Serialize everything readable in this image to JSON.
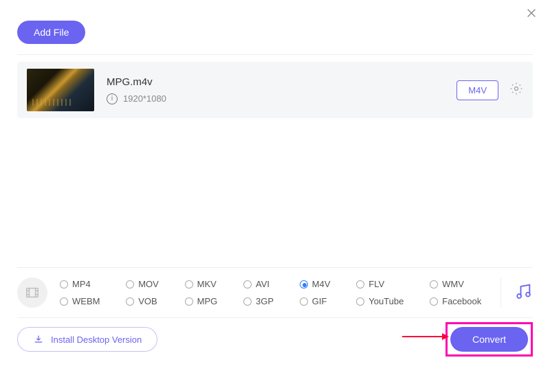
{
  "toolbar": {
    "add_file": "Add File"
  },
  "file": {
    "name": "MPG.m4v",
    "resolution": "1920*1080",
    "format_badge": "M4V"
  },
  "formats": {
    "row1": [
      "MP4",
      "MOV",
      "MKV",
      "AVI",
      "M4V",
      "FLV",
      "WMV"
    ],
    "row2": [
      "WEBM",
      "VOB",
      "MPG",
      "3GP",
      "GIF",
      "YouTube",
      "Facebook"
    ],
    "selected": "M4V"
  },
  "footer": {
    "install": "Install Desktop Version",
    "convert": "Convert"
  }
}
